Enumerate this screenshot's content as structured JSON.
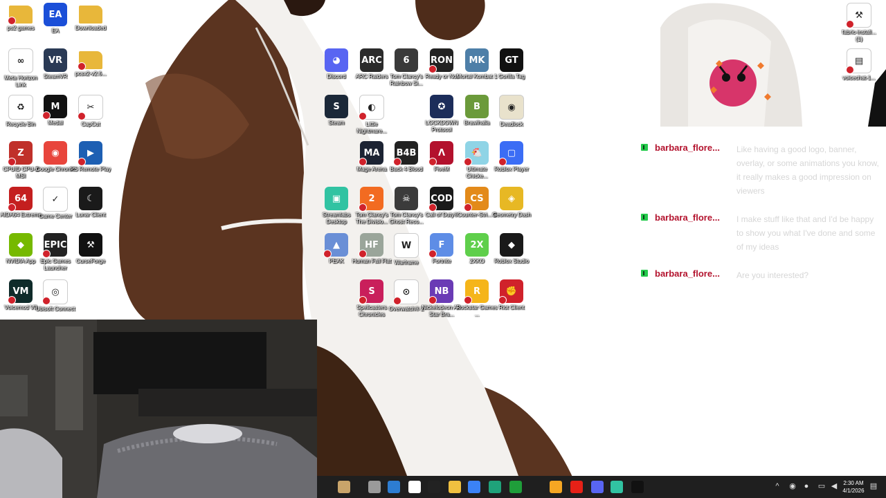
{
  "desktop": {
    "icons": [
      {
        "id": "ps2-games",
        "label": "ps2 games",
        "color": "#e8b73a",
        "glyph": "",
        "folder": true
      },
      {
        "id": "ea",
        "label": "EA",
        "color": "#1b4fd8",
        "glyph": "EA"
      },
      {
        "id": "downloaded",
        "label": "Downloaded",
        "color": "#e8b73a",
        "glyph": "",
        "folder": true
      },
      {
        "id": "meta-horizon-link",
        "label": "Meta Horizon Link",
        "color": "#ffffff",
        "glyph": "∞",
        "dark": true
      },
      {
        "id": "steamvr",
        "label": "SteamVR",
        "color": "#2a3a55",
        "glyph": "VR"
      },
      {
        "id": "pcsx2-folder",
        "label": "pcsx2-v2.6...",
        "color": "#e8b73a",
        "glyph": "",
        "folder": true
      },
      {
        "id": "recycle-bin",
        "label": "Recycle Bin",
        "color": "#ffffff",
        "glyph": "♻",
        "dark": true
      },
      {
        "id": "medal",
        "label": "Medal",
        "color": "#111111",
        "glyph": "M"
      },
      {
        "id": "capcut",
        "label": "CapCut",
        "color": "#ffffff",
        "glyph": "✂",
        "dark": true
      },
      {
        "id": "cpuid",
        "label": "CPUID CPU-Z MSI",
        "color": "#c0302a",
        "glyph": "Z"
      },
      {
        "id": "google-chrome",
        "label": "Google Chrome",
        "color": "#e8453c",
        "glyph": "◉"
      },
      {
        "id": "ps-remote-play",
        "label": "PS Remote Play",
        "color": "#1d5fb3",
        "glyph": "▶"
      },
      {
        "id": "aida64",
        "label": "AIDA64 Extreme",
        "color": "#c41f1f",
        "glyph": "64"
      },
      {
        "id": "game-center",
        "label": "Game Center",
        "color": "#ffffff",
        "glyph": "✓",
        "dark": true
      },
      {
        "id": "lunar-client",
        "label": "Lunar Client",
        "color": "#1a1a1a",
        "glyph": "☾"
      },
      {
        "id": "nvidia-app",
        "label": "NVIDIA App",
        "color": "#76b900",
        "glyph": "◆"
      },
      {
        "id": "epic-games",
        "label": "Epic Games Launcher",
        "color": "#222222",
        "glyph": "EPIC"
      },
      {
        "id": "curseforge",
        "label": "CurseForge",
        "color": "#111111",
        "glyph": "⚒"
      },
      {
        "id": "voicemod",
        "label": "Voicemod V3",
        "color": "#0f2b2a",
        "glyph": "VM"
      },
      {
        "id": "ubisoft-connect",
        "label": "Ubisoft Connect",
        "color": "#ffffff",
        "glyph": "◎",
        "dark": true
      },
      {
        "id": "discord",
        "label": "Discord",
        "color": "#5865f2",
        "glyph": "◕"
      },
      {
        "id": "arc-raiders",
        "label": "ARC Raiders",
        "color": "#2b2b2b",
        "glyph": "ARC"
      },
      {
        "id": "rainbow-six",
        "label": "Tom Clancy's Rainbow Si...",
        "color": "#3a3a3a",
        "glyph": "6"
      },
      {
        "id": "ready-or-not",
        "label": "Ready or Not",
        "color": "#222222",
        "glyph": "RON"
      },
      {
        "id": "mortal-kombat",
        "label": "Mortal Kombat 1",
        "color": "#4e7fa8",
        "glyph": "MK"
      },
      {
        "id": "gorilla-tag",
        "label": "Gorilla Tag",
        "color": "#111111",
        "glyph": "GT"
      },
      {
        "id": "steam",
        "label": "Steam",
        "color": "#1b2838",
        "glyph": "S"
      },
      {
        "id": "little-nightmares",
        "label": "Little Nightmare...",
        "color": "#ffffff",
        "glyph": "◐",
        "dark": true
      },
      {
        "id": "lockdown-protocol",
        "label": "LOCKDOWN Protocol",
        "color": "#1c2d5a",
        "glyph": "✪"
      },
      {
        "id": "brawlhalla",
        "label": "Brawlhalla",
        "color": "#6b9a3a",
        "glyph": "B"
      },
      {
        "id": "deadlock",
        "label": "Deadlock",
        "color": "#e9e2cc",
        "glyph": "◉",
        "dark": true
      },
      {
        "id": "mage-arena",
        "label": "Mage Arena",
        "color": "#1c2333",
        "glyph": "MA"
      },
      {
        "id": "back-4-blood",
        "label": "Back 4 Blood",
        "color": "#222222",
        "glyph": "B4B"
      },
      {
        "id": "fivem",
        "label": "FiveM",
        "color": "#b3112d",
        "glyph": "Λ"
      },
      {
        "id": "ultimate-chicken",
        "label": "Ultimate Chicke...",
        "color": "#8fd4e6",
        "glyph": "🐔"
      },
      {
        "id": "roblox-player",
        "label": "Roblox Player",
        "color": "#3b6df5",
        "glyph": "▢"
      },
      {
        "id": "streamlabs",
        "label": "Streamlabs Desktop",
        "color": "#31c3a2",
        "glyph": "▣"
      },
      {
        "id": "division-2",
        "label": "Tom Clancy's The Divisio...",
        "color": "#f26b21",
        "glyph": "2"
      },
      {
        "id": "ghost-recon",
        "label": "Tom Clancy's Ghost Reco...",
        "color": "#3b3b3b",
        "glyph": "☠"
      },
      {
        "id": "call-of-duty",
        "label": "Call of Duty®",
        "color": "#1a1a1a",
        "glyph": "COD"
      },
      {
        "id": "counter-strike",
        "label": "Counter-Stri... 2",
        "color": "#e38a1a",
        "glyph": "CS"
      },
      {
        "id": "geometry-dash",
        "label": "Geometry Dash",
        "color": "#e7b824",
        "glyph": "◈"
      },
      {
        "id": "peak",
        "label": "PEAK",
        "color": "#6a8fd6",
        "glyph": "▲"
      },
      {
        "id": "human-fall-flat",
        "label": "Human Fall Flat",
        "color": "#9aa59a",
        "glyph": "HF"
      },
      {
        "id": "warframe",
        "label": "Warframe",
        "color": "#ffffff",
        "glyph": "W",
        "dark": true
      },
      {
        "id": "fortnite",
        "label": "Fortnite",
        "color": "#5e8de6",
        "glyph": "F"
      },
      {
        "id": "2xko",
        "label": "2XKO",
        "color": "#5fcf4b",
        "glyph": "2X"
      },
      {
        "id": "roblox-studio",
        "label": "Roblox Studio",
        "color": "#1a1a1a",
        "glyph": "◆"
      },
      {
        "id": "spellcasters",
        "label": "Spellcasters Chronicles",
        "color": "#c91f5b",
        "glyph": "S"
      },
      {
        "id": "overwatch",
        "label": "Overwatch® 2",
        "color": "#ffffff",
        "glyph": "⊙",
        "dark": true
      },
      {
        "id": "nickelodeon-brawl",
        "label": "Nickelodeon All-Star Bra...",
        "color": "#6a3bb5",
        "glyph": "NB"
      },
      {
        "id": "rockstar-launcher",
        "label": "Rockstar Games ...",
        "color": "#f5b51a",
        "glyph": "R"
      },
      {
        "id": "riot-client",
        "label": "Riot Client",
        "color": "#d0222b",
        "glyph": "✊"
      },
      {
        "id": "fabric-installer",
        "label": "fabric-install... (1)",
        "color": "#ffffff",
        "glyph": "⚒",
        "dark": true
      },
      {
        "id": "voicechat-file",
        "label": "voicechat-1...",
        "color": "#ffffff",
        "glyph": "▤",
        "dark": true
      }
    ]
  },
  "chat": {
    "messages": [
      {
        "user": "barbara_flore...",
        "text": "Like having a good logo, banner, overlay, or some animations you know, it really makes a good impression on viewers"
      },
      {
        "user": "barbara_flore...",
        "text": "I make stuff like that and I'd be happy to show you what I've done and some of my ideas"
      },
      {
        "user": "barbara_flore...",
        "text": "Are you interested?"
      }
    ]
  },
  "taskbar": {
    "apps": [
      "widgets",
      "task-view",
      "store",
      "file",
      "amazon",
      "file-explorer",
      "copilot",
      "edge",
      "xbox",
      "brave",
      "youtube",
      "discord",
      "streamlabs",
      "tiktok"
    ],
    "clock": {
      "time": "2:30 AM",
      "date": "4/1/2026"
    }
  },
  "colors": {
    "chat_username": "#b3122d",
    "chat_text": "#d6d6d6",
    "chat_badge": "#24c94b",
    "taskbar_bg": "#1f1f1f"
  }
}
